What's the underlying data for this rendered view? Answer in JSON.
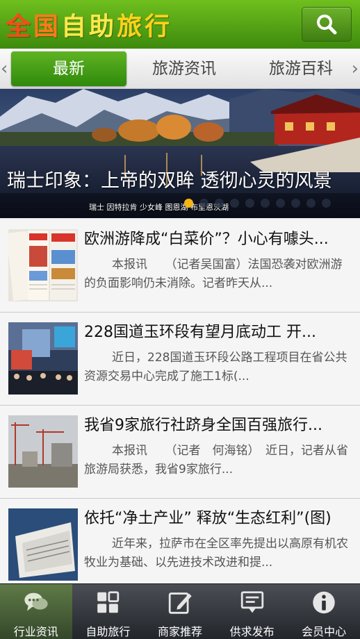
{
  "header": {
    "title_chars": [
      "全",
      "国",
      "自",
      "助",
      "旅",
      "行"
    ],
    "title_colors": [
      "#ff4a1a",
      "#ff7a1a",
      "#ffe84a",
      "#ffe84a",
      "#ffd21a",
      "#ffd21a"
    ],
    "search_icon": "search-icon"
  },
  "tabs": {
    "items": [
      "最新",
      "旅游资讯",
      "旅游百科"
    ],
    "active_index": 0,
    "left_arrow": "‹",
    "right_arrow": "›"
  },
  "banner": {
    "title": "瑞士印象：上帝的双眸 透彻心灵的风景",
    "caption": "瑞士 因特拉肯 少女峰 图恩湖 布里恩茨湖",
    "slide_count": 10,
    "active_slide": 0
  },
  "news": [
    {
      "title": "欧洲游降成“白菜价”？小心有噱头...",
      "summary": "本报讯　　（记者吴国富）法国恐袭对欧洲游的负面影响仍未消除。记者昨天从...",
      "thumb": "newspaper"
    },
    {
      "title": "228国道玉环段有望月底动工 开...",
      "summary": "近日，228国道玉环段公路工程项目在省公共资源交易中心完成了施工1标(...",
      "thumb": "exhibition"
    },
    {
      "title": "我省9家旅行社跻身全国百强旅行...",
      "summary": "本报讯　　（记者　何海铭）　近日，记者从省旅游局获悉，我省9家旅行...",
      "thumb": "construction"
    },
    {
      "title": "依托“净土产业” 释放“生态红利”(图)",
      "summary": "近年来，拉萨市在全区率先提出以高原有机农牧业为基础、以先进技术改进和提...",
      "thumb": "papers"
    }
  ],
  "bottom_nav": {
    "items": [
      {
        "label": "行业资讯",
        "icon": "chat-bubbles-icon"
      },
      {
        "label": "自助旅行",
        "icon": "grid-icon"
      },
      {
        "label": "商家推荐",
        "icon": "edit-icon"
      },
      {
        "label": "供求发布",
        "icon": "message-icon"
      },
      {
        "label": "会员中心",
        "icon": "info-icon"
      }
    ],
    "active_index": 0
  },
  "colors": {
    "header_green": "#4fa414",
    "active_tab_green": "#3f9a14",
    "active_dot": "#f3b414",
    "nav_dark": "#2d3035"
  }
}
